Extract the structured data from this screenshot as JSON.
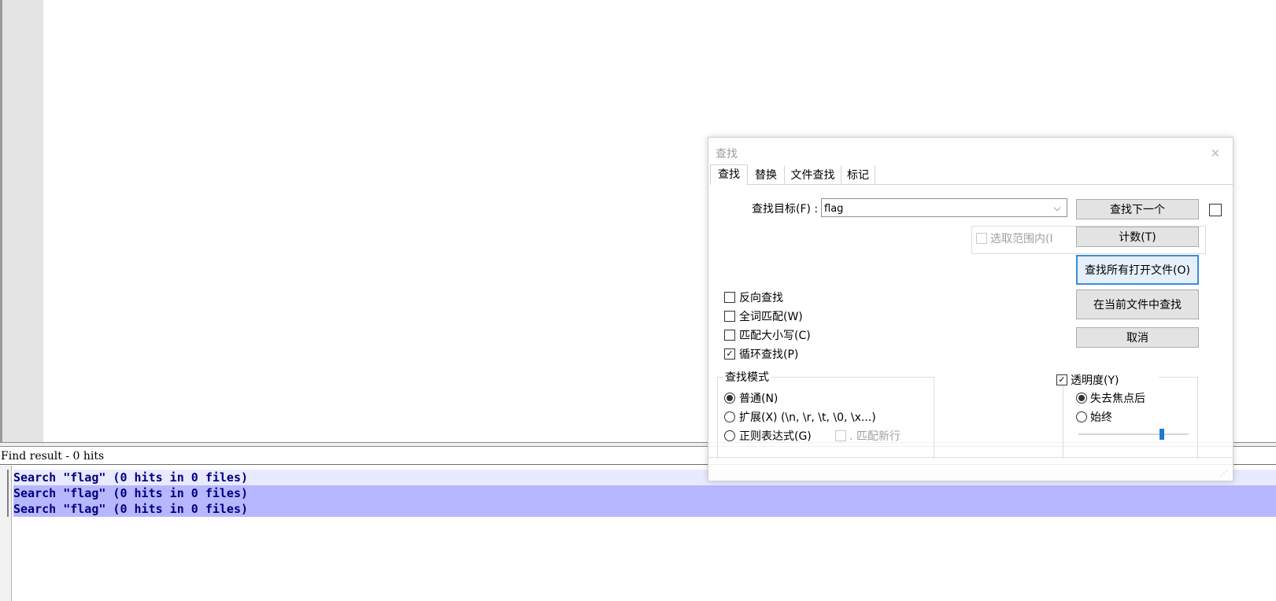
{
  "result_panel": {
    "title": "Find result - 0 hits",
    "lines": [
      "Search \"flag\" (0 hits in 0 files)",
      "Search \"flag\" (0 hits in 0 files)",
      "Search \"flag\" (0 hits in 0 files)"
    ]
  },
  "dialog": {
    "title": "查找",
    "close_icon": "close-icon",
    "tabs": [
      {
        "label": "查找",
        "active": true
      },
      {
        "label": "替换",
        "active": false
      },
      {
        "label": "文件查找",
        "active": false
      },
      {
        "label": "标记",
        "active": false
      }
    ],
    "find_label": "查找目标(F) :",
    "find_value": "flag",
    "in_selection_label": "选取范围内(I",
    "buttons": {
      "find_next": "查找下一个",
      "count": "计数(T)",
      "find_all_open": "查找所有打开文件(O)",
      "find_in_current": "在当前文件中查找",
      "cancel": "取消"
    },
    "options": [
      {
        "label": "反向查找",
        "checked": false
      },
      {
        "label": "全词匹配(W)",
        "checked": false
      },
      {
        "label": "匹配大小写(C)",
        "checked": false
      },
      {
        "label": "循环查找(P)",
        "checked": true
      }
    ],
    "search_mode": {
      "title": "查找模式",
      "normal": "普通(N)",
      "extended": "扩展(X) (\\n, \\r, \\t, \\0, \\x...)",
      "regex": "正则表达式(G)",
      "match_newline": ". 匹配新行",
      "selected": "normal"
    },
    "transparency": {
      "label": "透明度(Y)",
      "checked": true,
      "on_losing_focus": "失去焦点后",
      "always": "始终",
      "selected": "on_losing_focus",
      "level": 0.66
    }
  },
  "colors": {
    "result_text": "#000080",
    "result_highlight": "#b7b7ff",
    "focus_border": "#3b8cd6"
  }
}
